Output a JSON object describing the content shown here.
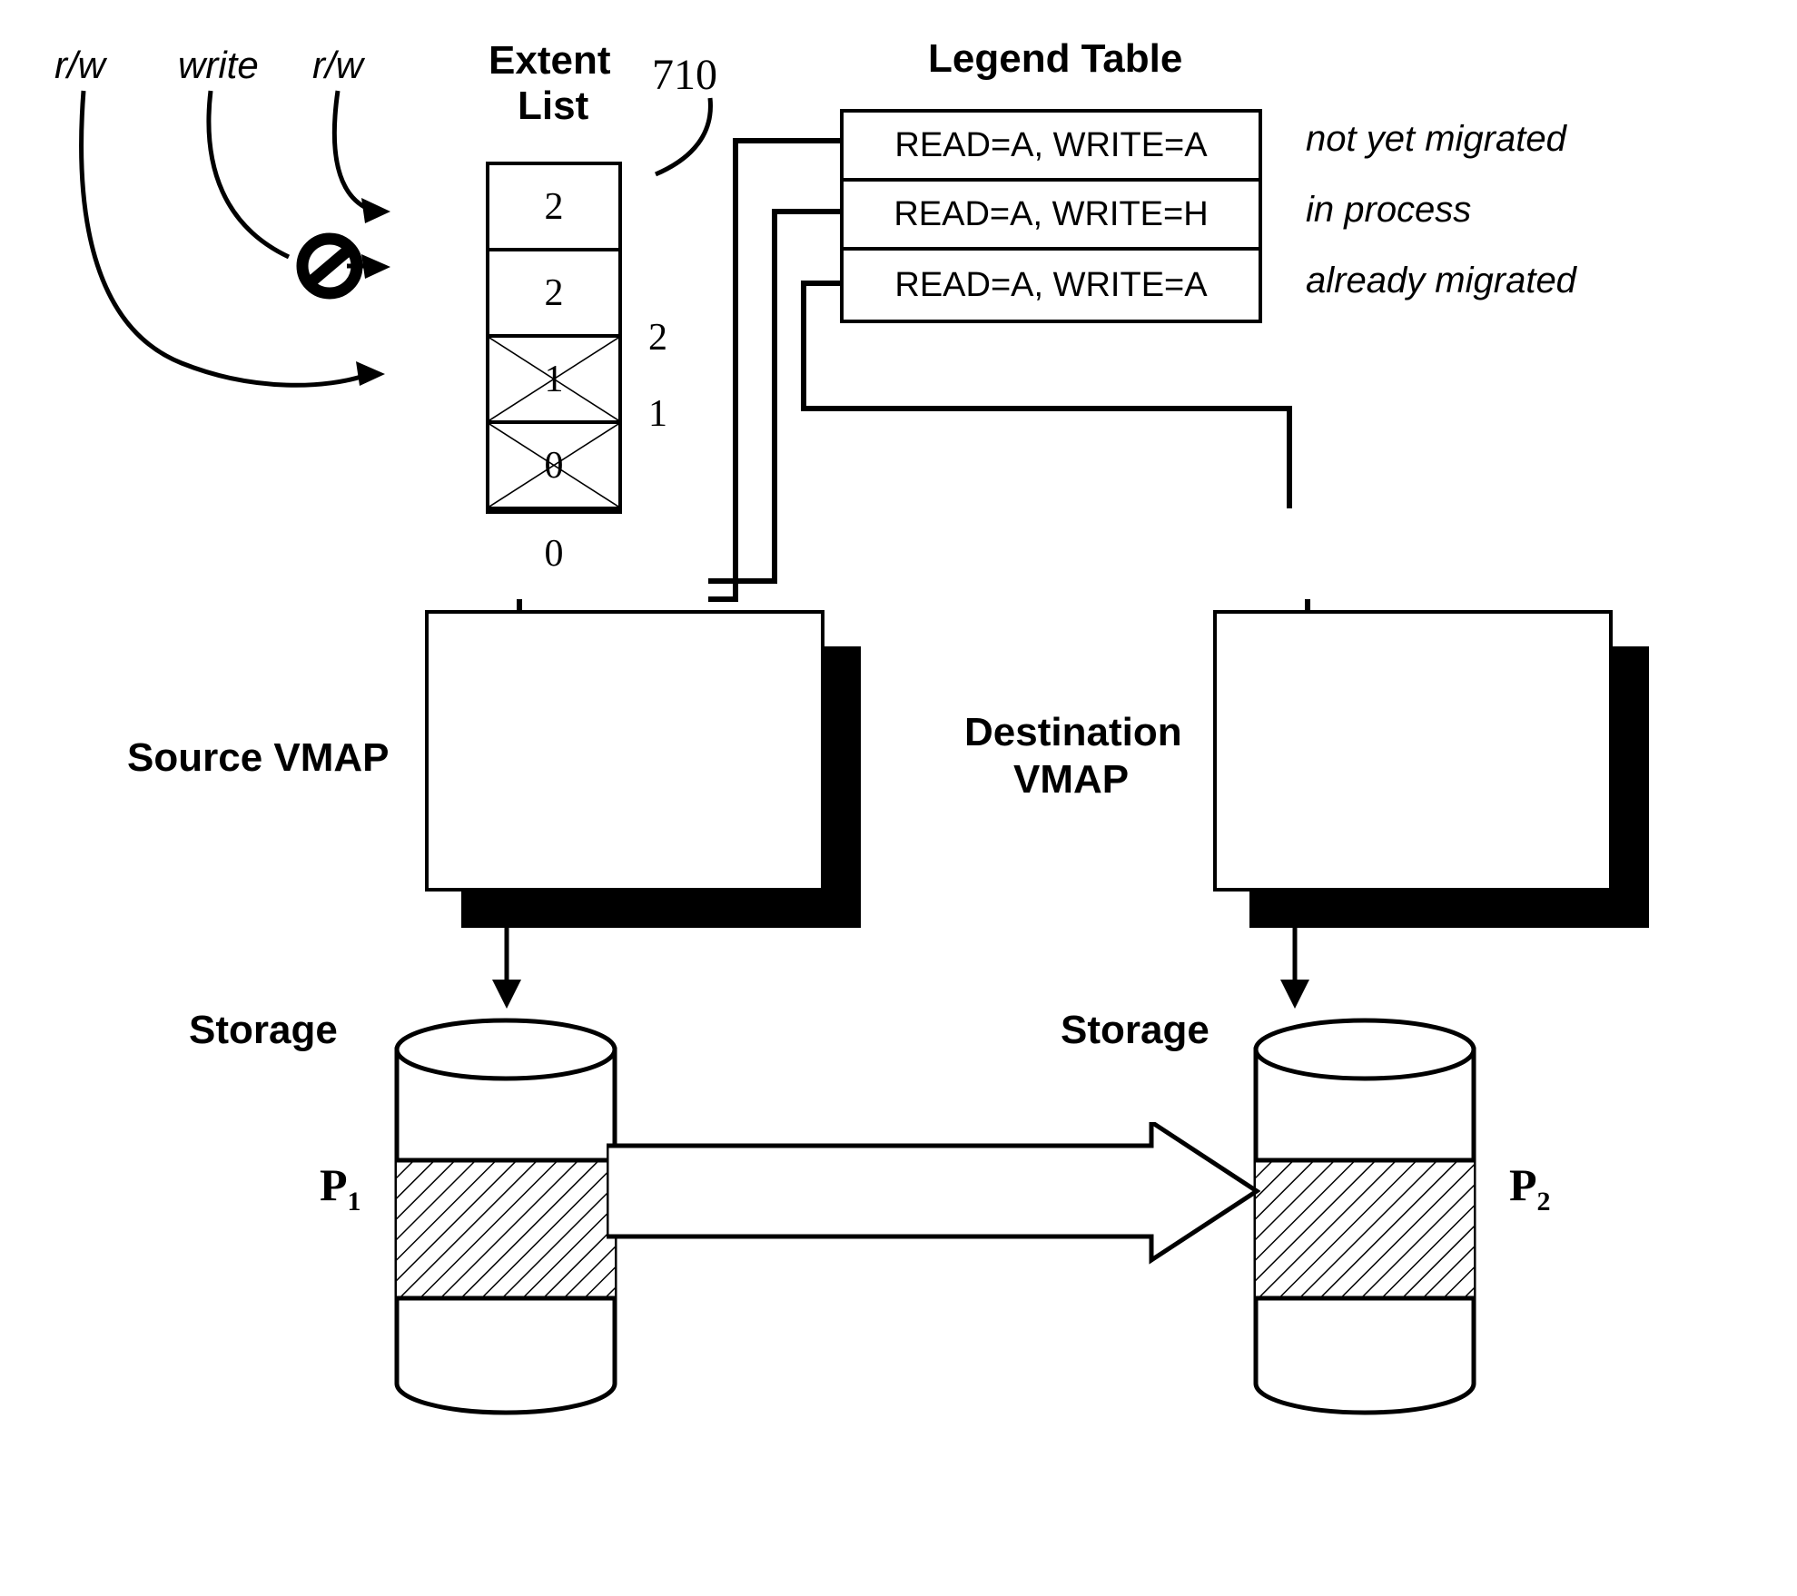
{
  "annotations": {
    "rw_left": "r/w",
    "write": "write",
    "rw_right": "r/w"
  },
  "extent_list": {
    "title_line1": "Extent",
    "title_line2": "List",
    "callout": "710",
    "cells": [
      {
        "value": "2",
        "crossed": false
      },
      {
        "value": "2",
        "crossed": false
      },
      {
        "value": "1",
        "crossed": true
      },
      {
        "value": "0",
        "crossed": true
      },
      {
        "value": "0",
        "crossed": false
      }
    ],
    "side_markers": [
      "2",
      "1"
    ]
  },
  "legend": {
    "title": "Legend Table",
    "rows": [
      {
        "rule": "READ=A, WRITE=A",
        "meaning": "not yet migrated"
      },
      {
        "rule": "READ=A, WRITE=H",
        "meaning": "in process"
      },
      {
        "rule": "READ=A, WRITE=A",
        "meaning": "already migrated"
      }
    ]
  },
  "vmaps": {
    "source_label": "Source VMAP",
    "destination_label_line1": "Destination",
    "destination_label_line2": "VMAP"
  },
  "storage": {
    "source_label": "Storage",
    "destination_label": "Storage",
    "source_disk": "P",
    "source_disk_sub": "1",
    "destination_disk": "P",
    "destination_disk_sub": "2"
  },
  "colors": {
    "stroke": "#000000",
    "fill": "#ffffff",
    "shadow": "#000000"
  }
}
